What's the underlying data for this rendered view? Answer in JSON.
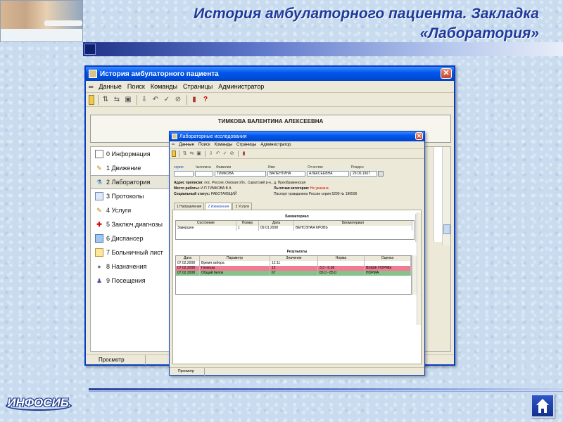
{
  "slide": {
    "title": "История амбулаторного пациента. Закладка «Лаборатория»",
    "footer_logo": "ИНФОСИБ"
  },
  "main_window": {
    "title": "История амбулаторного пациента",
    "close_label": "✕",
    "menu": [
      "═",
      "Данные",
      "Поиск",
      "Команды",
      "Страницы",
      "Администратор"
    ],
    "patient_name": "ТИМКОВА ВАЛЕНТИНА АЛЕКСЕЕВНА",
    "nav_items": [
      {
        "label": "0 Информация",
        "icon": "info-card-icon"
      },
      {
        "label": "1 Движение",
        "icon": "movement-icon"
      },
      {
        "label": "2 Лаборатория",
        "icon": "lab-flask-icon"
      },
      {
        "label": "3 Протоколы",
        "icon": "protocol-icon"
      },
      {
        "label": "4 Услуги",
        "icon": "services-icon"
      },
      {
        "label": "5 Заключ.диагнозы",
        "icon": "diagnosis-icon"
      },
      {
        "label": "6 Диспансер",
        "icon": "dispensary-icon"
      },
      {
        "label": "7 Больничный лист",
        "icon": "sick-leave-icon"
      },
      {
        "label": "8 Назначения",
        "icon": "prescription-icon"
      },
      {
        "label": "9 Посещения",
        "icon": "visits-icon"
      }
    ],
    "active_nav": 2,
    "status": "Просмотр"
  },
  "lab_window": {
    "title": "Лабораторные исследования",
    "close_label": "✕",
    "menu": [
      "═",
      "Данные",
      "Поиск",
      "Команды",
      "Страницы",
      "Администратор"
    ],
    "fields": {
      "series_label": "серия",
      "policy_label": "№полиса",
      "lastname_label": "Фамилия",
      "firstname_label": "Имя",
      "patronymic_label": "Отчество",
      "born_label": "Рожден",
      "lastname": "ТИМКОВА",
      "firstname": "ВАЛЕНТИНА",
      "patronymic": "АЛЕКСЕЕВНА",
      "born": "29.06.1967"
    },
    "info": {
      "address_label": "Адрес прописки:",
      "address": "пос. Россия, Омская обл., Саратский р-н., д. Преображенская",
      "work_label": "Место работы:",
      "work": "И П ТИМКОВА В А",
      "benefit_label": "Льготная категория:",
      "benefit": "Не указана",
      "social_label": "Социальный статус:",
      "social": "РАБОТАЮЩИЙ",
      "passport": "Паспорт гражданина России серия 5299 № 196596"
    },
    "tabs": [
      "1 Направления",
      "2 Измерения",
      "3 Услуги"
    ],
    "active_tab": 1,
    "biomaterial": {
      "title": "Биоматериал",
      "headers": [
        "Состояние",
        "Номер",
        "Дата",
        "Биоматериал"
      ],
      "rows": [
        [
          "Завершен",
          "1",
          "09.01.2008",
          "ВЕНОЗНАЯ КРОВЬ"
        ]
      ]
    },
    "results": {
      "title": "Результаты",
      "headers": [
        "Дата",
        "Параметр",
        "Значение",
        "Норма",
        "Оценка"
      ],
      "rows": [
        [
          "07.02.2008",
          "Время забора",
          "12:11",
          "",
          ""
        ],
        [
          "07.02.2008",
          "Глюкоза",
          "12",
          "3.3 - 6.38",
          "ВЫШЕ НОРМЫ"
        ],
        [
          "07.02.2008",
          "Общий белок",
          "67",
          "65.0 - 85.0",
          "НОРМА"
        ]
      ]
    },
    "status": "Просмотр"
  },
  "colors": {
    "title_blue": "#1f3a9b",
    "xp_titlebar": "#0058ee",
    "above_norm_row": "#f07b93",
    "norm_row": "#85c38a"
  }
}
